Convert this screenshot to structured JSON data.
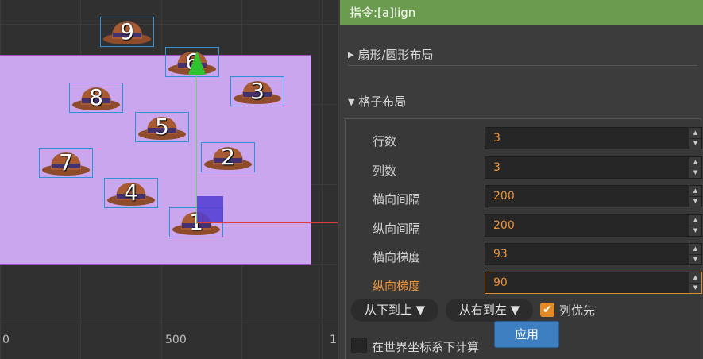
{
  "scene": {
    "ruler_labels": [
      "0",
      "500",
      "1"
    ],
    "hats": [
      {
        "number": "9"
      },
      {
        "number": "6"
      },
      {
        "number": "3"
      },
      {
        "number": "8"
      },
      {
        "number": "5"
      },
      {
        "number": "2"
      },
      {
        "number": "7"
      },
      {
        "number": "4"
      },
      {
        "number": "1"
      }
    ]
  },
  "panel": {
    "header": "指令:[a]lign",
    "fan_section": {
      "arrow": "▶",
      "title": "扇形/圆形布局"
    },
    "grid_section": {
      "arrow": "▼",
      "title": "格子布局"
    },
    "fields": [
      {
        "label": "行数",
        "value": "3"
      },
      {
        "label": "列数",
        "value": "3"
      },
      {
        "label": "横向间隔",
        "value": "200"
      },
      {
        "label": "纵向间隔",
        "value": "200"
      },
      {
        "label": "横向梯度",
        "value": "93"
      },
      {
        "label": "纵向梯度",
        "value": "90"
      }
    ],
    "vertical_order": "从下到上 ▼",
    "horizontal_order": "从右到左 ▼",
    "column_first": {
      "label": "列优先",
      "checked": true
    },
    "apply_label": "应用",
    "world_coords": {
      "label": "在世界坐标系下计算",
      "checked": false
    }
  },
  "colors": {
    "header_bg": "#6b9b4f",
    "accent": "#e38b28",
    "apply_bg": "#3e7fc1",
    "canvas_bg": "#c9a6ee"
  }
}
